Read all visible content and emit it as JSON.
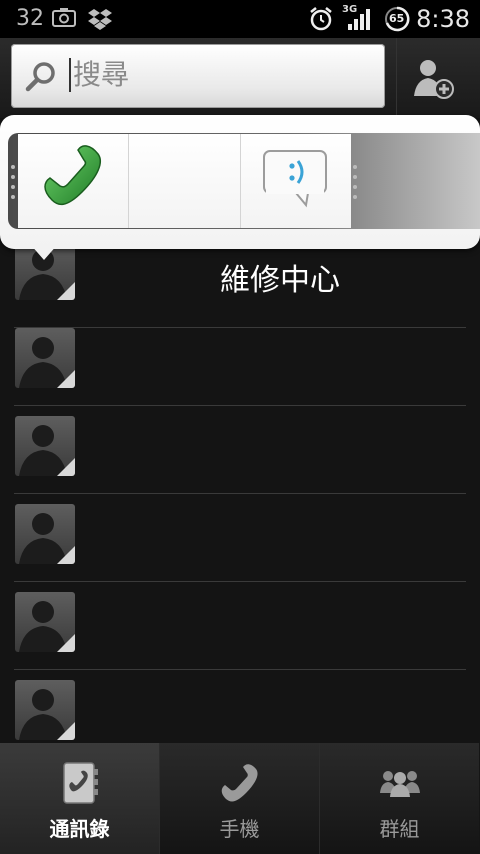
{
  "status_bar": {
    "notification_count": "32",
    "battery_level": "65",
    "network": "3G",
    "time": "8:38"
  },
  "search": {
    "placeholder": "搜尋"
  },
  "popup": {
    "actions": [
      "call",
      "empty",
      "sms"
    ]
  },
  "contacts": [
    {
      "name": "維修中心"
    },
    {
      "name": ""
    },
    {
      "name": ""
    },
    {
      "name": ""
    },
    {
      "name": ""
    },
    {
      "name": ""
    }
  ],
  "tabs": [
    {
      "label": "通訊錄",
      "icon": "contacts-book-icon",
      "active": true
    },
    {
      "label": "手機",
      "icon": "phone-icon",
      "active": false
    },
    {
      "label": "群組",
      "icon": "group-icon",
      "active": false
    }
  ],
  "colors": {
    "call_green": "#2e9b3a",
    "background": "#141414",
    "sms_accent": "#3aa3d6"
  }
}
